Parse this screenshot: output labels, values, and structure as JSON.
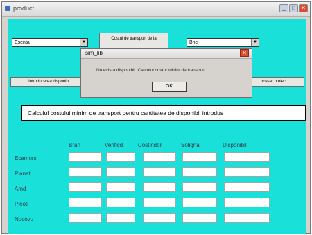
{
  "window": {
    "title": "product"
  },
  "controls": {
    "combo_left_value": "Esenta",
    "combo_right_value": "Bric",
    "top_button_label": "Costul de transport de la",
    "left_button_label": "Introducerea disponib",
    "right_button_label": "ncesar proiec",
    "wide_button_label": "Calculul costului minim de transport pentru cantitatea de disponibil introdus"
  },
  "grid": {
    "columns": [
      "Bran",
      "Verificd",
      "Costindor",
      "Soligna",
      "Disponibil"
    ],
    "rows": [
      "Ecamorsi",
      "Planeti",
      "Amd",
      "Pleoti",
      "Nocovu"
    ]
  },
  "dialog": {
    "title": "sim_lib",
    "message": "Nu exista disponibil. Calcului costul minim de transport.",
    "ok_label": "OK"
  }
}
